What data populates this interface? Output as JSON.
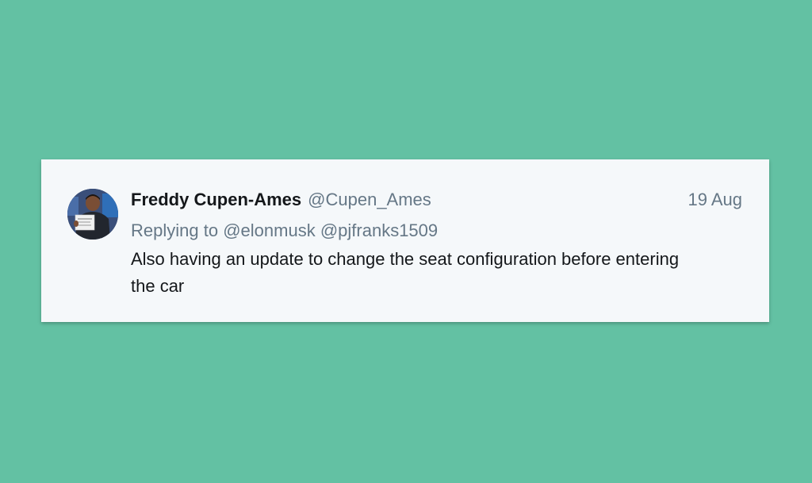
{
  "tweet": {
    "display_name": "Freddy Cupen-Ames",
    "handle": "@Cupen_Ames",
    "timestamp": "19 Aug",
    "replying_prefix": "Replying to",
    "mentions": [
      "@elonmusk",
      "@pjfranks1509"
    ],
    "text": "Also having an update to change the seat configuration before entering the car"
  },
  "colors": {
    "background": "#63c1a3",
    "card": "#f5f8fa",
    "primary_text": "#14171a",
    "secondary_text": "#657786"
  }
}
